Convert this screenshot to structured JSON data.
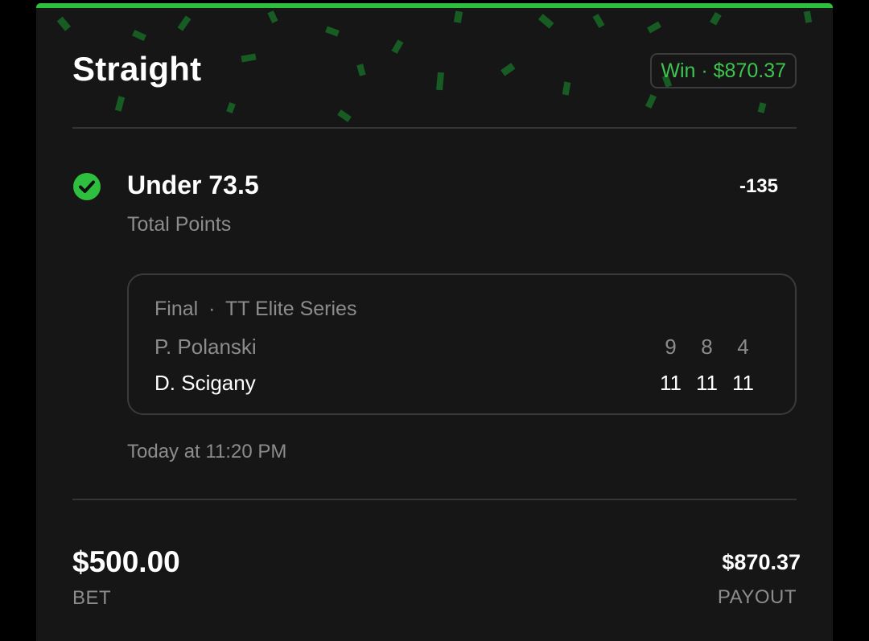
{
  "bet": {
    "type": "Straight",
    "result": "Win · $870.37",
    "selection": "Under 73.5",
    "odds": "-135",
    "market": "Total Points",
    "status_icon": "checkmark-circle-icon",
    "timestamp": "Today at 11:20 PM",
    "stake": "$500.00",
    "stake_label": "BET",
    "payout": "$870.37",
    "payout_label": "PAYOUT"
  },
  "event": {
    "status": "Final",
    "separator": "·",
    "league": "TT Elite Series",
    "players": [
      {
        "name": "P. Polanski",
        "scores": [
          "9",
          "8",
          "4"
        ]
      },
      {
        "name": "D. Scigany",
        "scores": [
          "11",
          "11",
          "11"
        ]
      }
    ]
  },
  "colors": {
    "accent_green": "#2fbf3f",
    "win_text": "#3ec44f",
    "card_bg": "#161616",
    "muted_text": "#8c8c8c"
  }
}
